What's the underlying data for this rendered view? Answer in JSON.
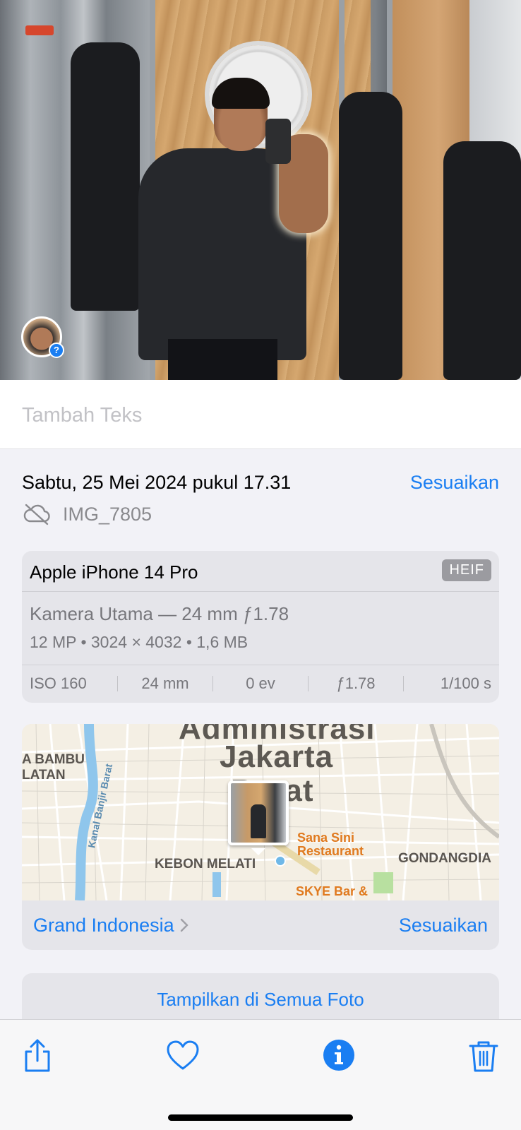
{
  "caption": {
    "placeholder": "Tambah Teks"
  },
  "info": {
    "date": "Sabtu, 25 Mei 2024 pukul 17.31",
    "adjust_label": "Sesuaikan",
    "filename": "IMG_7805",
    "cloud_icon": "icloud-slash-icon"
  },
  "device": {
    "name": "Apple iPhone 14 Pro",
    "format": "HEIF",
    "lens": "Kamera Utama — 24 mm ƒ1.78",
    "specs": "12 MP  •  3024 × 4032  •  1,6 MB",
    "exif": [
      "ISO 160",
      "24 mm",
      "0 ev",
      "ƒ1.78",
      "1/100 s"
    ]
  },
  "map": {
    "labels": {
      "district_top": "Administrasi",
      "city": "Jakarta",
      "city2": "Barat",
      "bambu": "A BAMBU",
      "latan": "LATAN",
      "canal": "Kanal Banjir Barat",
      "kebon": "KEBON MELATI",
      "gondangdia": "GONDANGDIA"
    },
    "pois": {
      "sana_sini": "Sana Sini Restaurant",
      "skye": "SKYE Bar &"
    },
    "place": "Grand Indonesia",
    "adjust_label": "Sesuaikan",
    "accent": "#1a7ef2"
  },
  "show_all": "Tampilkan di Semua Foto",
  "toolbar": {
    "icons": [
      "share-icon",
      "heart-icon",
      "info-icon",
      "trash-icon"
    ]
  }
}
